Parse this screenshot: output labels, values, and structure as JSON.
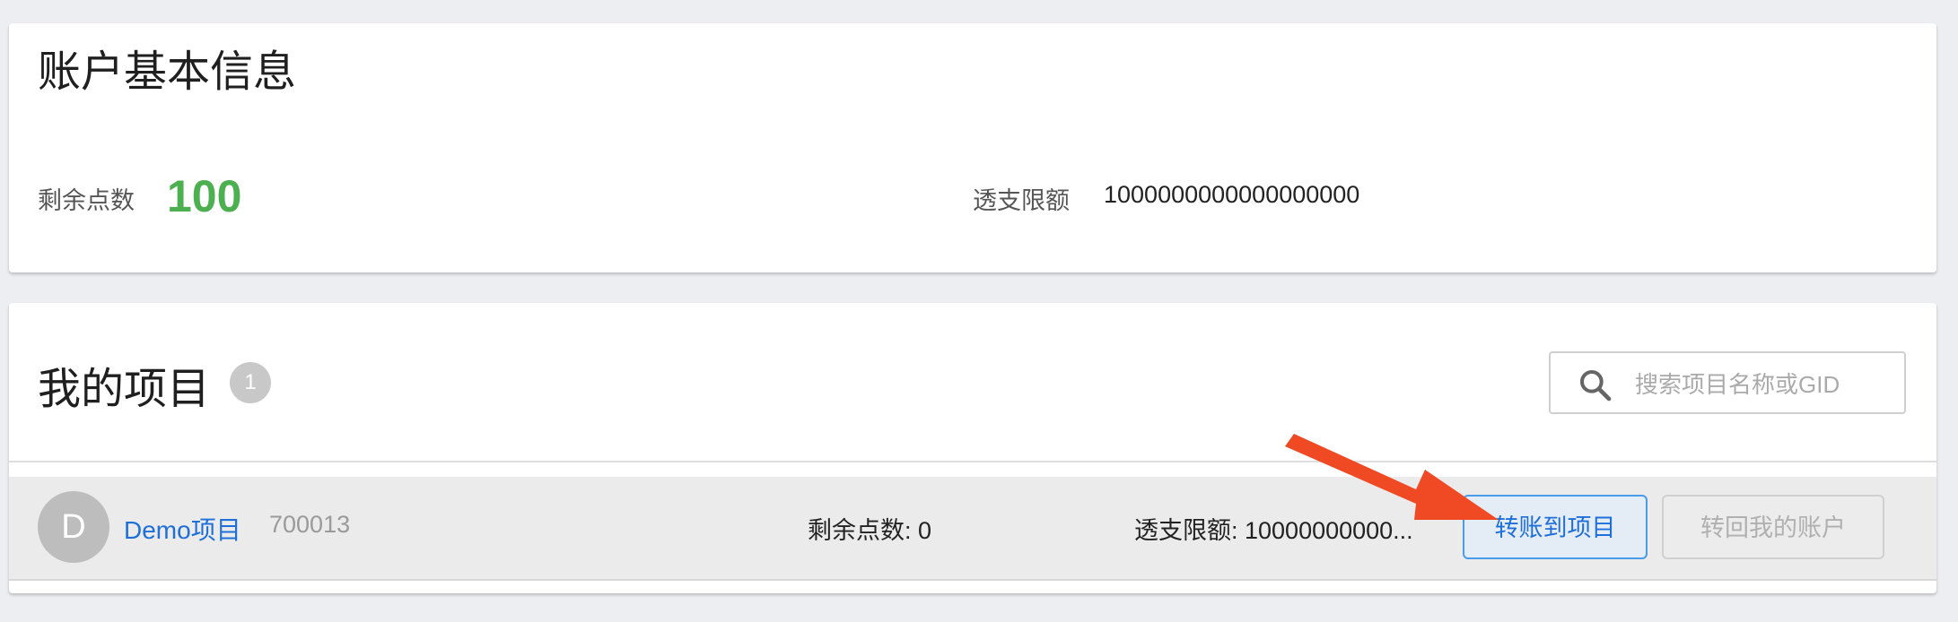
{
  "account": {
    "title": "账户基本信息",
    "remaining_label": "剩余点数",
    "remaining_value": "100",
    "overdraft_label": "透支限额",
    "overdraft_value": "1000000000000000000"
  },
  "projects": {
    "title": "我的项目",
    "count": "1",
    "search": {
      "placeholder": "搜索项目名称或GID",
      "value": ""
    },
    "rows": [
      {
        "avatar_letter": "D",
        "name": "Demo项目",
        "gid": "700013",
        "remaining": "剩余点数: 0",
        "overdraft": "透支限额: 10000000000...",
        "transfer_to_button": "转账到项目",
        "transfer_back_button": "转回我的账户"
      }
    ]
  },
  "colors": {
    "accent": "#1e6fd9",
    "remaining_value": "#4caf50",
    "annotation_arrow": "#f04a24"
  },
  "icons": {
    "search": "search-icon",
    "annotation": "arrow-annotation-icon"
  }
}
